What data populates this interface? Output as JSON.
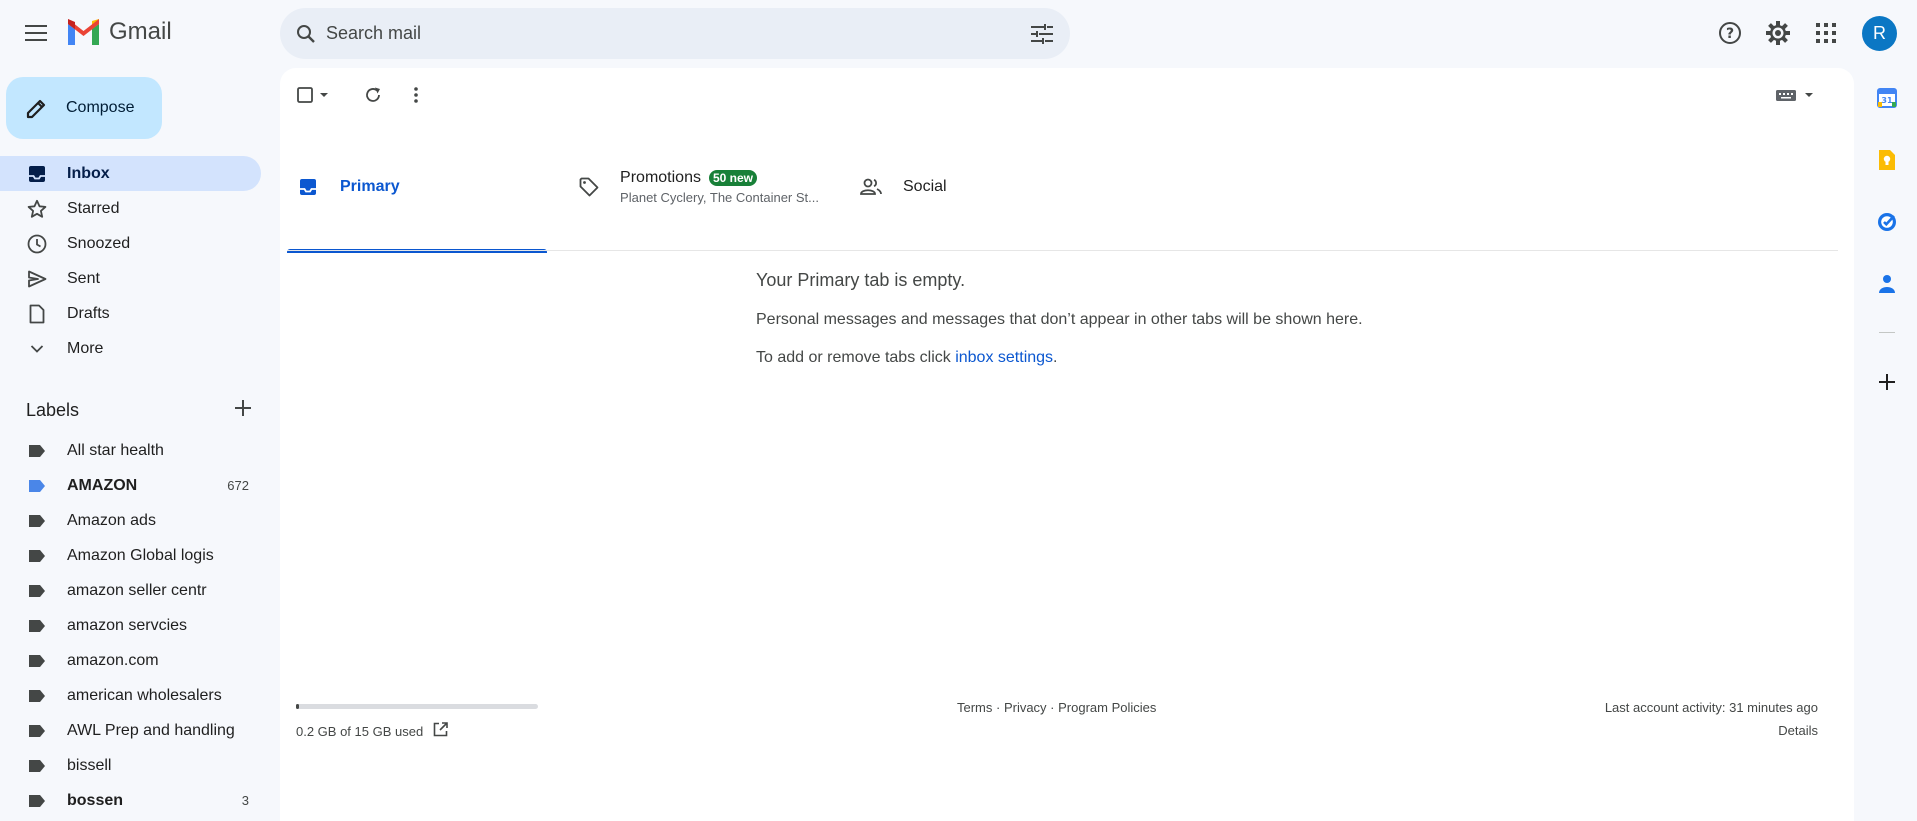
{
  "app": {
    "name": "Gmail"
  },
  "header": {
    "search_placeholder": "Search mail",
    "avatar_initial": "R",
    "icons": [
      "main-menu-icon",
      "search-icon",
      "search-options-icon",
      "help-icon",
      "settings-icon",
      "apps-icon"
    ]
  },
  "sidebar": {
    "compose_label": "Compose",
    "items": [
      {
        "label": "Inbox",
        "icon": "inbox-icon",
        "active": true
      },
      {
        "label": "Starred",
        "icon": "star-icon"
      },
      {
        "label": "Snoozed",
        "icon": "clock-icon"
      },
      {
        "label": "Sent",
        "icon": "send-icon"
      },
      {
        "label": "Drafts",
        "icon": "draft-icon"
      },
      {
        "label": "More",
        "icon": "chevron-down-icon"
      }
    ],
    "labels_title": "Labels",
    "labels": [
      {
        "name": "All star health",
        "count": "",
        "bold": false,
        "color": "#444746"
      },
      {
        "name": "AMAZON",
        "count": "672",
        "bold": true,
        "color": "#4a86e8"
      },
      {
        "name": "Amazon ads",
        "count": "",
        "bold": false,
        "color": "#444746"
      },
      {
        "name": "Amazon Global logis",
        "count": "",
        "bold": false,
        "color": "#444746"
      },
      {
        "name": "amazon seller centr",
        "count": "",
        "bold": false,
        "color": "#444746"
      },
      {
        "name": "amazon servcies",
        "count": "",
        "bold": false,
        "color": "#444746"
      },
      {
        "name": "amazon.com",
        "count": "",
        "bold": false,
        "color": "#444746"
      },
      {
        "name": "american wholesalers",
        "count": "",
        "bold": false,
        "color": "#444746"
      },
      {
        "name": "AWL Prep and handling",
        "count": "",
        "bold": false,
        "color": "#444746"
      },
      {
        "name": "bissell",
        "count": "",
        "bold": false,
        "color": "#444746"
      },
      {
        "name": "bossen",
        "count": "3",
        "bold": true,
        "color": "#444746"
      }
    ]
  },
  "tabs": {
    "primary": "Primary",
    "promotions": "Promotions",
    "promotions_badge": "50 new",
    "promotions_sub": "Planet Cyclery, The Container St...",
    "social": "Social"
  },
  "empty_state": {
    "title": "Your Primary tab is empty.",
    "description": "Personal messages and messages that don’t appear in other tabs will be shown here.",
    "tabs_prefix": "To add or remove tabs click ",
    "tabs_link": "inbox settings",
    "tabs_suffix": "."
  },
  "footer": {
    "storage_text": "0.2 GB of 15 GB used",
    "storage_used_fraction": 0.013,
    "links": "Terms · Privacy · Program Policies",
    "last_activity": "Last account activity: 31 minutes ago",
    "details": "Details"
  },
  "colors": {
    "accent": "#0b57d0",
    "compose_bg": "#c2e7ff",
    "active_nav": "#d3e3fd",
    "badge_green": "#188038",
    "avatar": "#0b77c4"
  }
}
